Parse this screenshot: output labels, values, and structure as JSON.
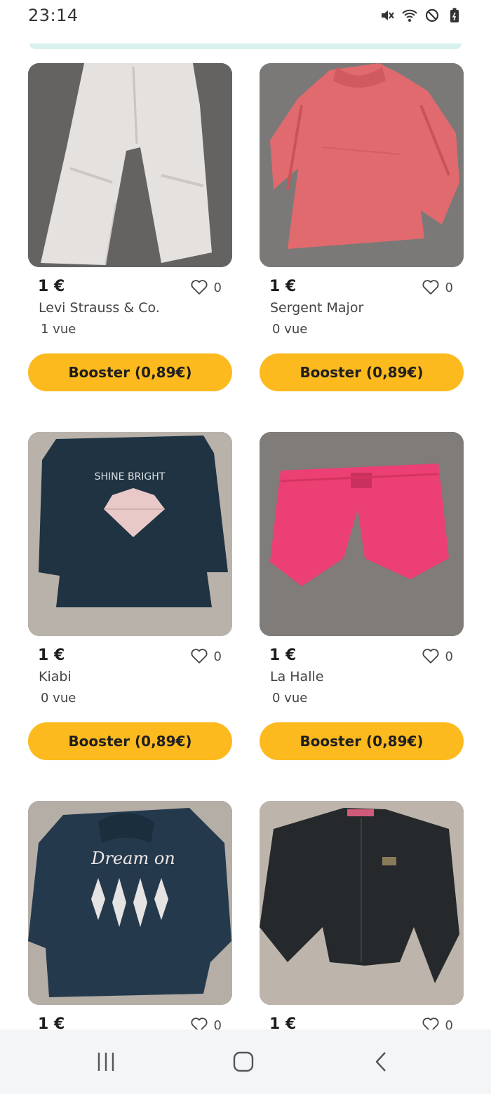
{
  "status_bar": {
    "time": "23:14",
    "icons": [
      "mute-icon",
      "wifi-icon",
      "do-not-disturb-icon",
      "battery-icon"
    ]
  },
  "listings": [
    {
      "price": "1 €",
      "likes": "0",
      "brand": "Levi Strauss & Co.",
      "views": "1 vue",
      "boost_label": "Booster (0,89€)",
      "photo": "light grey trousers on grey carpet"
    },
    {
      "price": "1 €",
      "likes": "0",
      "brand": "Sergent Major",
      "views": "0 vue",
      "boost_label": "Booster (0,89€)",
      "photo": "pink long-sleeve top on grey carpet"
    },
    {
      "price": "1 €",
      "likes": "0",
      "brand": "Kiabi",
      "views": "0 vue",
      "boost_label": "Booster (0,89€)",
      "photo": "navy long-sleeve top with diamond print"
    },
    {
      "price": "1 €",
      "likes": "0",
      "brand": "La Halle",
      "views": "0 vue",
      "boost_label": "Booster (0,89€)",
      "photo": "pink shorts on grey carpet"
    },
    {
      "price": "1 €",
      "likes": "0",
      "brand": "",
      "views": "",
      "boost_label": "",
      "photo": "navy hoodie with Dream on print"
    },
    {
      "price": "1 €",
      "likes": "0",
      "brand": "",
      "views": "",
      "boost_label": "",
      "photo": "black cardigan on beige carpet"
    }
  ],
  "nav_bar": {
    "buttons": [
      "recent-apps-icon",
      "home-icon",
      "back-icon"
    ]
  },
  "colors": {
    "accent": "#fcba1e",
    "divider": "#d8f0ee"
  }
}
